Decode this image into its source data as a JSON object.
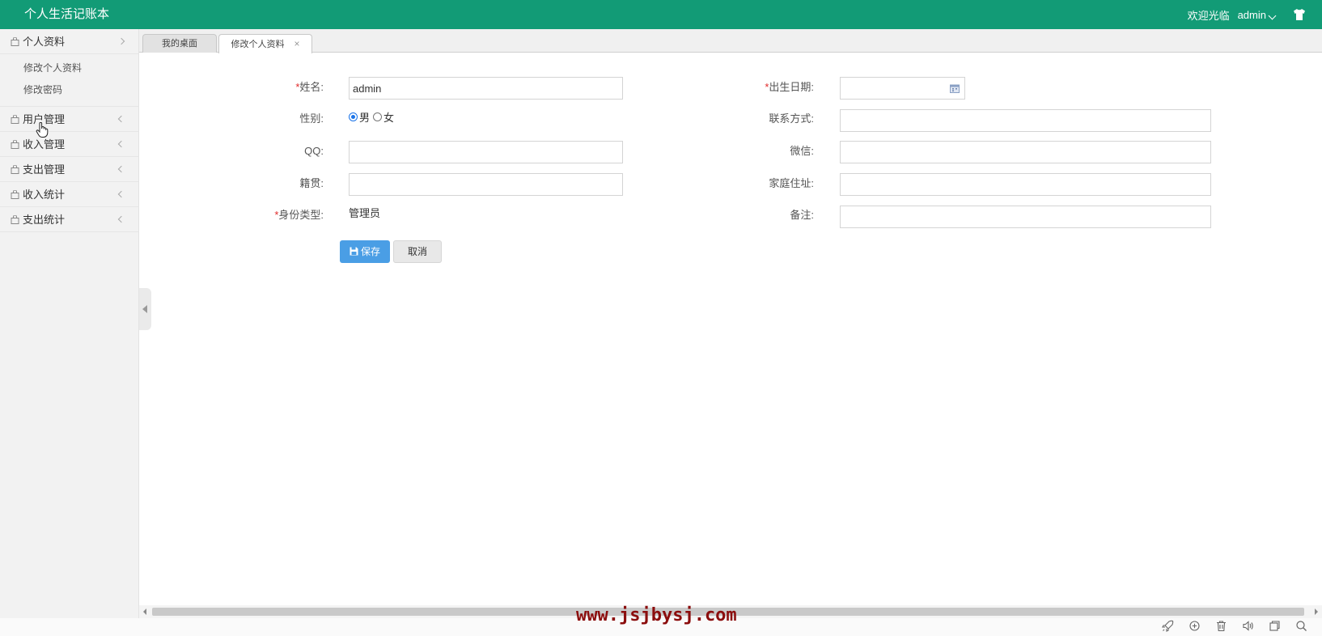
{
  "header": {
    "title": "个人生活记账本",
    "welcome": "欢迎光临",
    "username": "admin"
  },
  "sidebar": {
    "items": [
      {
        "label": "个人资料",
        "expanded": true,
        "children": [
          "修改个人资料",
          "修改密码"
        ]
      },
      {
        "label": "用户管理"
      },
      {
        "label": "收入管理"
      },
      {
        "label": "支出管理"
      },
      {
        "label": "收入统计"
      },
      {
        "label": "支出统计"
      }
    ]
  },
  "tabs": [
    {
      "label": "我的桌面"
    },
    {
      "label": "修改个人资料",
      "close": "×"
    }
  ],
  "form": {
    "name": {
      "label": "姓名:",
      "value": "admin",
      "required": "*"
    },
    "gender": {
      "label": "性别:",
      "options": [
        "男",
        "女"
      ],
      "selected": "男"
    },
    "qq": {
      "label": "QQ:",
      "value": ""
    },
    "origin": {
      "label": "籍贯:",
      "value": ""
    },
    "identity": {
      "label": "身份类型:",
      "value": "管理员",
      "required": "*"
    },
    "birth": {
      "label": "出生日期:",
      "value": "",
      "required": "*"
    },
    "contact": {
      "label": "联系方式:",
      "value": ""
    },
    "wechat": {
      "label": "微信:",
      "value": ""
    },
    "address": {
      "label": "家庭住址:",
      "value": ""
    },
    "remark": {
      "label": "备注:",
      "value": ""
    },
    "save": "保存",
    "cancel": "取消"
  },
  "watermark": "www.jsjbysj.com",
  "colors": {
    "header": "#129b76",
    "primary_button": "#4a9ee5",
    "required": "#e02b2b"
  }
}
